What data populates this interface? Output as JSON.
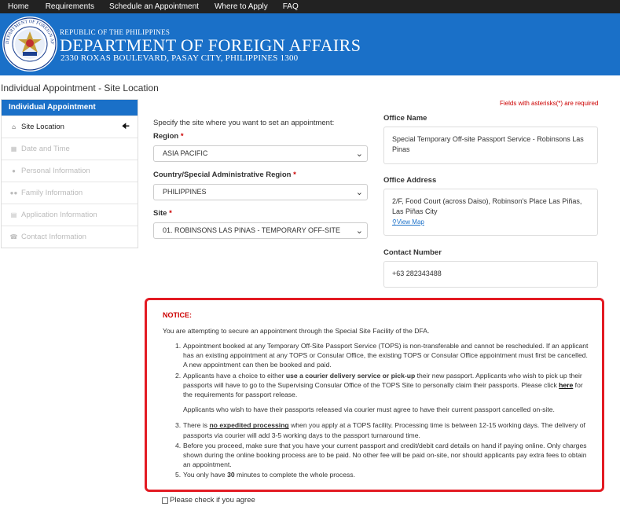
{
  "nav": {
    "items": [
      "Home",
      "Requirements",
      "Schedule an Appointment",
      "Where to Apply",
      "FAQ"
    ]
  },
  "banner": {
    "republic": "REPUBLIC OF THE PHILIPPINES",
    "dept": "DEPARTMENT OF FOREIGN AFFAIRS",
    "address": "2330 ROXAS BOULEVARD, PASAY CITY, PHILIPPINES 1300",
    "seal_text": "DEPARTMENT OF FOREIGN AFFAIRS"
  },
  "page_title": "Individual Appointment - Site Location",
  "sidebar": {
    "heading": "Individual Appointment",
    "items": [
      {
        "label": "Site Location",
        "icon": "home-icon"
      },
      {
        "label": "Date and Time",
        "icon": "calendar-icon"
      },
      {
        "label": "Personal Information",
        "icon": "user-icon"
      },
      {
        "label": "Family Information",
        "icon": "users-icon"
      },
      {
        "label": "Application Information",
        "icon": "card-icon"
      },
      {
        "label": "Contact Information",
        "icon": "phone-icon"
      }
    ]
  },
  "form": {
    "required_note": "Fields with asterisks(*) are required",
    "specify": "Specify the site where you want to set an appointment:",
    "region_label": "Region",
    "region_value": "ASIA PACIFIC",
    "country_label": "Country/Special Administrative Region",
    "country_value": "PHILIPPINES",
    "site_label": "Site",
    "site_value": "01. ROBINSONS LAS PINAS - TEMPORARY OFF-SITE",
    "asterisk": "*"
  },
  "office": {
    "name_label": "Office Name",
    "name": "Special Temporary Off-site Passport Service - Robinsons Las Pinas",
    "address_label": "Office Address",
    "address": "2/F, Food Court (across Daiso), Robinson's Place Las Piñas, Las Piñas City",
    "map_link": "View Map",
    "contact_label": "Contact Number",
    "contact": "+63 282343488"
  },
  "notice": {
    "title": "NOTICE:",
    "intro": "You are attempting to secure an appointment through the Special Site Facility of the DFA.",
    "item1": "Appointment booked at any Temporary Off-Site Passport Service (TOPS) is non-transferable and cannot be rescheduled. If an applicant has an existing appointment at any TOPS or Consular Office, the existing TOPS or Consular Office appointment must first be cancelled. A new appointment can then be booked and paid.",
    "item2_a": "Applicants have a choice to either ",
    "item2_bold": "use a courier delivery service or pick-up",
    "item2_b": " their new passport. Applicants who wish to pick up their passports will have to go to the Supervising Consular Office of the TOPS Site to personally claim their passports. Please click ",
    "item2_link": "here",
    "item2_c": " for the requirements for passport release.",
    "item2_sub": "Applicants who wish to have their passports released via courier must agree to have their current passport cancelled on-site.",
    "item3_a": "There is ",
    "item3_bold": "no expedited processing",
    "item3_b": " when you apply at a TOPS facility. Processing time is between 12-15 working days. The delivery of passports via courier will add 3-5 working days to the passport turnaround time.",
    "item4": "Before you proceed, make sure that you have your current passport and credit/debit card details on hand if paying online. Only charges shown during the online booking process are to be paid. No other fee will be paid on-site, nor should applicants pay extra fees to obtain an appointment.",
    "item5_a": "You only have ",
    "item5_bold": "30",
    "item5_b": " minutes to complete the whole process.",
    "nums": [
      "1.",
      "2.",
      "3.",
      "4.",
      "5."
    ]
  },
  "agree_label": "Please check if you agree",
  "colors": {
    "nav_bg": "#222222",
    "banner": "#1a70c8",
    "notice_border": "#e31b23",
    "required": "#cc0000"
  }
}
